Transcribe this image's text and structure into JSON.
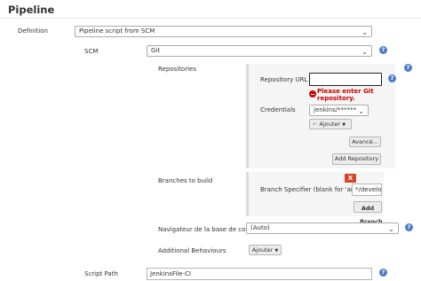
{
  "section_title": "Pipeline",
  "definition": {
    "label": "Definition",
    "value": "Pipeline script from SCM"
  },
  "scm": {
    "label": "SCM",
    "value": "Git"
  },
  "repositories": {
    "label": "Repositories",
    "url_label": "Repository URL",
    "url_value": "",
    "url_error": "Please enter Git repository.",
    "credentials_label": "Credentials",
    "credentials_value": "jenkins/******",
    "add_credentials_label": "Ajouter",
    "advanced_label": "Avancé...",
    "add_repository_label": "Add Repository"
  },
  "branches": {
    "label": "Branches to build",
    "delete_label": "X",
    "specifier_label": "Branch Specifier (blank for 'any')",
    "specifier_value": "*/develop",
    "add_branch_label": "Add Branch"
  },
  "repo_browser": {
    "label": "Navigateur de la base de code",
    "value": "(Auto)"
  },
  "additional_behaviours": {
    "label": "Additional Behaviours",
    "add_label": "Ajouter"
  },
  "script_path": {
    "label": "Script Path",
    "value": "JenkinsFile-CI"
  },
  "help_glyph": "?",
  "icons": {
    "help": "help-icon",
    "error": "error-icon",
    "key": "key-icon",
    "dropdown": "chevron-down-icon"
  },
  "colors": {
    "help": "#4a7ec7",
    "error": "#cc0000",
    "delete": "#d24726",
    "panel": "#f5f5f5"
  }
}
